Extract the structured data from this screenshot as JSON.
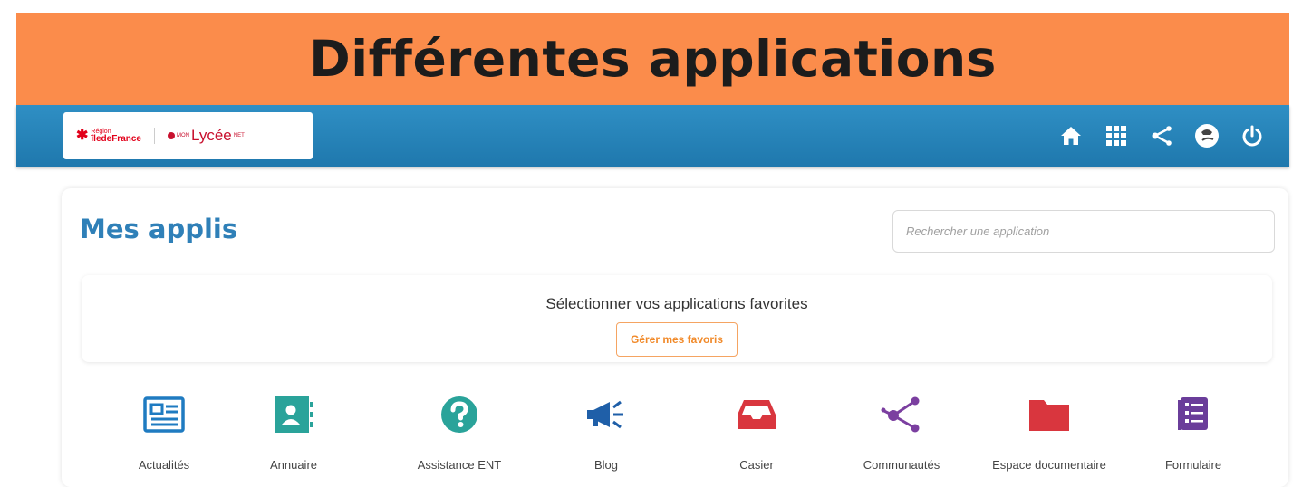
{
  "banner": {
    "title": "Différentes applications"
  },
  "topbar": {
    "logo": {
      "region_small": "Région",
      "region_big": "îledeFrance",
      "mon": "MON",
      "lycee": "Lycée",
      "net": "NET"
    },
    "icons": [
      "home-icon",
      "apps-grid-icon",
      "share-icon",
      "avatar-icon",
      "power-icon"
    ]
  },
  "main": {
    "title": "Mes applis",
    "search": {
      "placeholder": "Rechercher une application",
      "value": ""
    },
    "favorites": {
      "text": "Sélectionner vos applications favorites",
      "button_label": "Gérer mes favoris"
    },
    "apps": [
      {
        "label": "Actualités",
        "icon": "newspaper-icon",
        "color": "#1f7bc1"
      },
      {
        "label": "Annuaire",
        "icon": "contact-book-icon",
        "color": "#2aa39a"
      },
      {
        "label": "Assistance ENT",
        "icon": "question-icon",
        "color": "#2aa39a"
      },
      {
        "label": "Blog",
        "icon": "megaphone-icon",
        "color": "#1f5fa8"
      },
      {
        "label": "Casier",
        "icon": "inbox-tray-icon",
        "color": "#d9363e"
      },
      {
        "label": "Communautés",
        "icon": "share-network-icon",
        "color": "#7b3fa0"
      },
      {
        "label": "Espace documentaire",
        "icon": "folder-icon",
        "color": "#d9363e"
      },
      {
        "label": "Formulaire",
        "icon": "form-list-icon",
        "color": "#6a3d9a"
      }
    ]
  },
  "colors": {
    "banner": "#fb8c4b",
    "topbar": "#2385b9",
    "title": "#2f80b8",
    "accent": "#f18a2a"
  }
}
